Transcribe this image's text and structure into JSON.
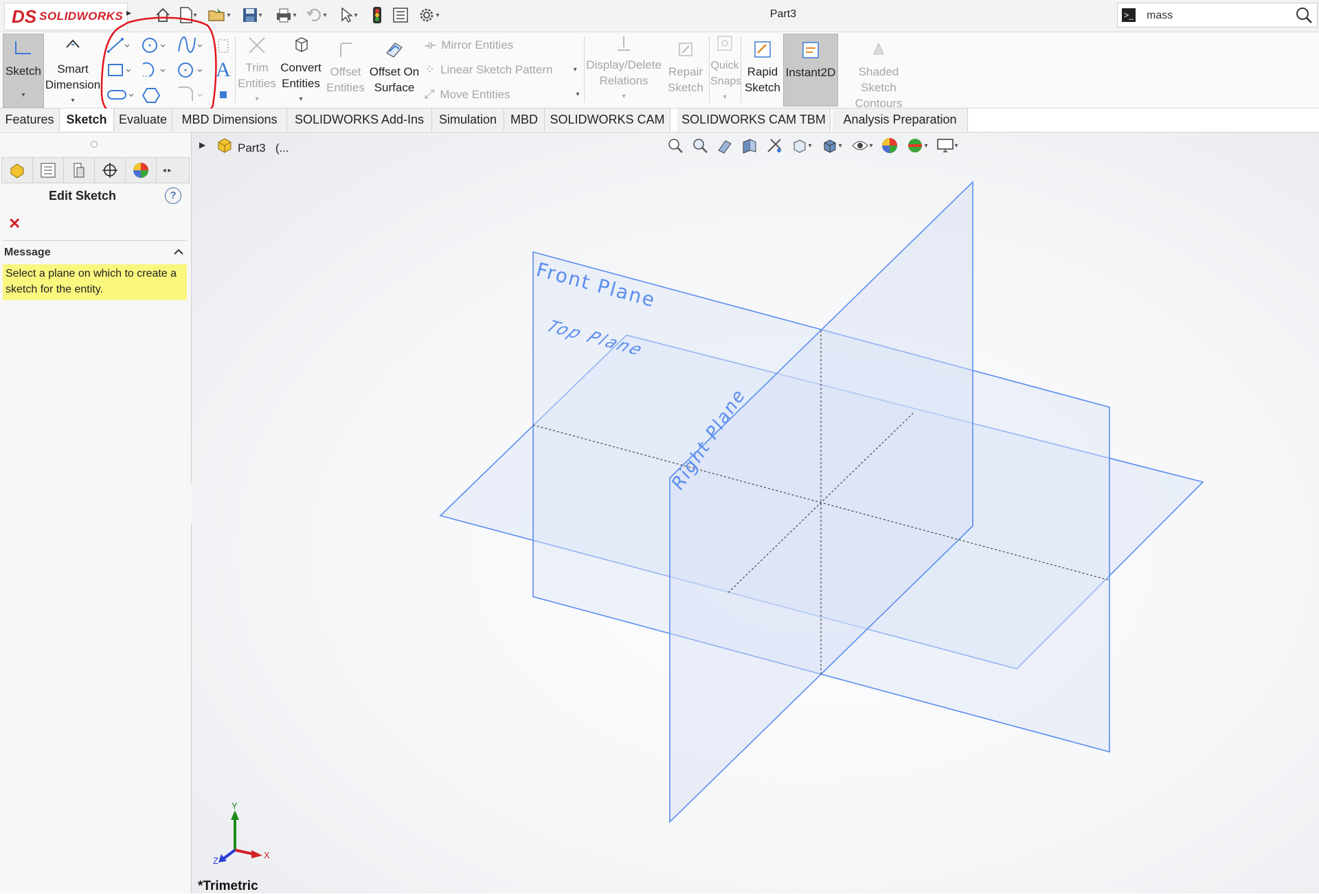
{
  "app": {
    "brand": "SOLIDWORKS",
    "brand_mark": "DS",
    "document_title": "Part3"
  },
  "search": {
    "value": "mass",
    "icon": "search-icon",
    "prompt_icon": "command-prompt-icon"
  },
  "quick_access": [
    "home-icon",
    "new-document-icon",
    "open-icon",
    "save-icon",
    "print-icon",
    "undo-icon",
    "select-icon",
    "rebuild-icon",
    "file-properties-icon",
    "options-icon"
  ],
  "ribbon": {
    "sketch": "Sketch",
    "smart_dimension": [
      "Smart",
      "Dimension"
    ],
    "trim_entities": [
      "Trim",
      "Entities"
    ],
    "convert_entities": [
      "Convert",
      "Entities"
    ],
    "offset_entities": [
      "Offset",
      "Entities"
    ],
    "offset_on_surface": [
      "Offset On",
      "Surface"
    ],
    "mirror_entities": "Mirror Entities",
    "linear_sketch_pattern": "Linear Sketch Pattern",
    "move_entities": "Move Entities",
    "display_delete_relations": [
      "Display/Delete",
      "Relations"
    ],
    "repair_sketch": [
      "Repair",
      "Sketch"
    ],
    "quick_snaps": [
      "Quick",
      "Snaps"
    ],
    "rapid_sketch": [
      "Rapid",
      "Sketch"
    ],
    "instant2d": "Instant2D",
    "shaded_sketch_contours": [
      "Shaded Sketch",
      "Contours"
    ],
    "text_glyph": "A",
    "sketch_tools": [
      "line-icon",
      "circle-icon",
      "spline-icon",
      "rectangle-icon",
      "arc-icon",
      "ellipse-icon",
      "slot-icon",
      "polygon-icon",
      "fillet-icon"
    ]
  },
  "tabs": [
    "Features",
    "Sketch",
    "Evaluate",
    "MBD Dimensions",
    "SOLIDWORKS Add-Ins",
    "Simulation",
    "MBD",
    "SOLIDWORKS CAM",
    "SOLIDWORKS CAM TBM",
    "Analysis Preparation"
  ],
  "active_tab": "Sketch",
  "panel": {
    "title": "Edit Sketch",
    "help": "?",
    "close": "✕",
    "message_header": "Message",
    "message": "Select a plane on which to create a sketch for the entity."
  },
  "tree": {
    "part": "Part3",
    "suffix": "(..."
  },
  "viewport": {
    "planes": [
      "Front Plane",
      "Top Plane",
      "Right Plane"
    ],
    "view_orientation": "*Trimetric",
    "axes": {
      "x": "X",
      "y": "Y",
      "z": "Z"
    },
    "plane_color": "#5b8def"
  },
  "annotation": {
    "highlight_color": "#e0141e",
    "target": "sketch-tools-group"
  }
}
